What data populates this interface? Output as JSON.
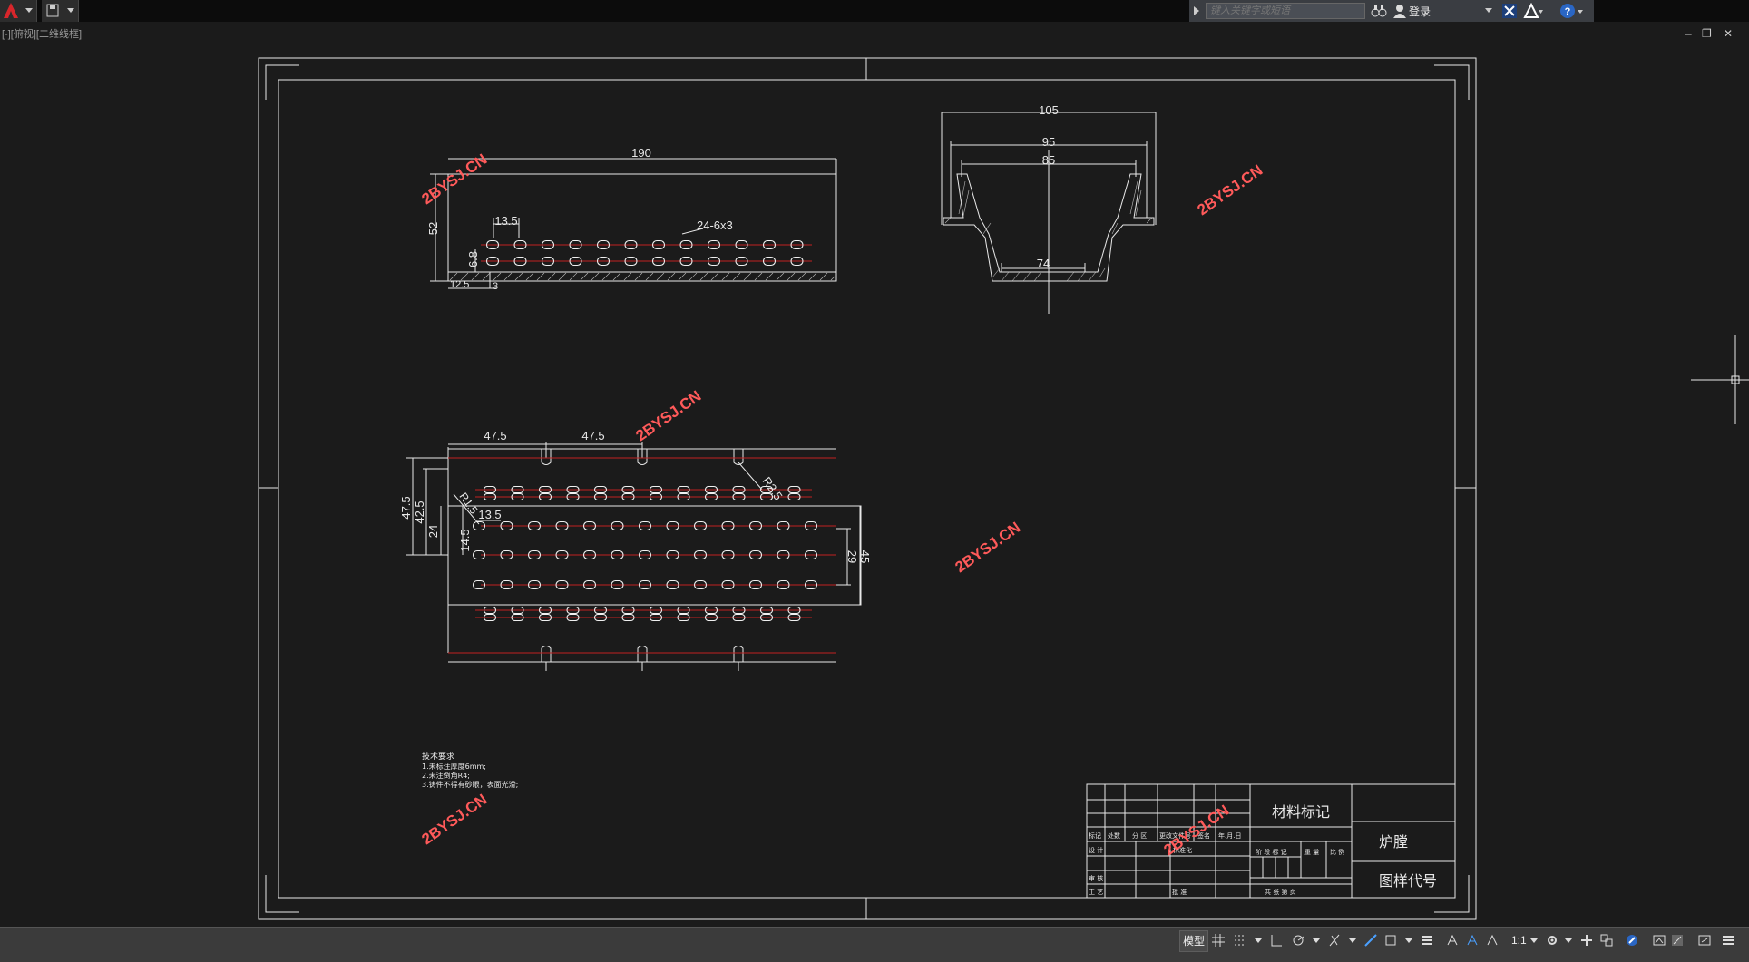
{
  "app": {
    "search_placeholder": "键入关键字或短语",
    "login_label": "登录",
    "viewport_label": "[-][俯视][二维线框]"
  },
  "drawing": {
    "top_view": {
      "dim_length": "190",
      "dim_height": "52",
      "dim_pitch": "13.5",
      "dim_slot": "24-6x3",
      "dim_row": "6.8",
      "dim_left": "12.5",
      "dim_small": "3"
    },
    "section_view": {
      "dim_top": "105",
      "dim_mid": "95",
      "dim_inner": "85",
      "dim_bottom": "74"
    },
    "plan_view": {
      "dim_a": "47.5",
      "dim_b": "47.5",
      "dim_radius": "R2.5",
      "dim_h1": "47.5",
      "dim_h2": "42.5",
      "dim_h3": "24",
      "dim_h4": "14.5",
      "dim_pitch": "13.5",
      "dim_r": "R1.5",
      "dim_right1": "29",
      "dim_right2": "45"
    },
    "watermark": "2BYSJ.CN",
    "notes": {
      "title": "技术要求",
      "line1": "1.未标注厚度6mm;",
      "line2": "2.未注倒角R4;",
      "line3": "3.铸件不得有砂眼，表面光滑;"
    },
    "title_block": {
      "material": "材料标记",
      "part_name": "炉膛",
      "drawing_no": "图样代号",
      "h_mark": "标记",
      "h_count": "处数",
      "h_zone": "分 区",
      "h_doc": "更改文件号",
      "h_sign": "签名",
      "h_date": "年.月.日",
      "h_design": "设 计",
      "h_std": "标准化",
      "h_stage": "阶 段 标 记",
      "h_weight": "重 量",
      "h_scale": "比 例",
      "h_review": "审 核",
      "h_process": "工 艺",
      "h_approve": "批 准",
      "h_sheets": "共   张   第   页"
    }
  },
  "status": {
    "model_label": "模型",
    "scale_label": "1:1"
  }
}
